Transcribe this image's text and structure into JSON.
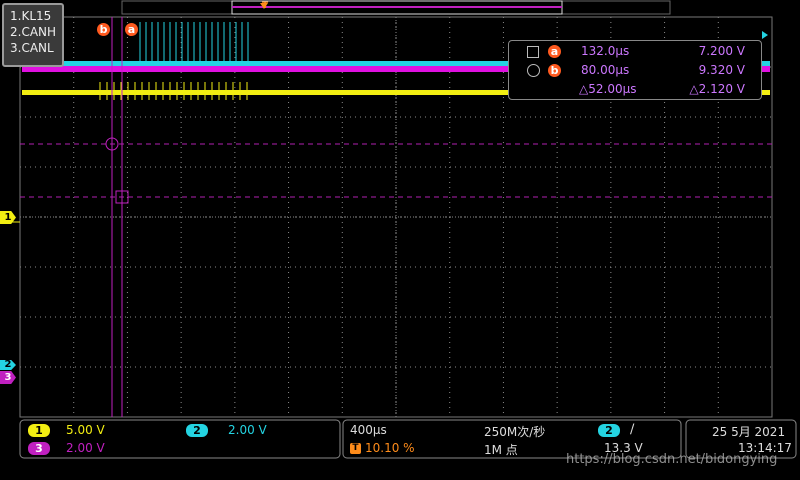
{
  "channel_legend": [
    "1.KL15",
    "2.CANH",
    "3.CANL"
  ],
  "trigger_marker": "T",
  "markers": {
    "b": "b",
    "a": "a"
  },
  "measure": {
    "row_a": {
      "time": "132.0μs",
      "volt": "7.200 V"
    },
    "row_b": {
      "time": "80.00μs",
      "volt": "9.320 V"
    },
    "delta": {
      "time": "△52.00μs",
      "volt": "△2.120 V"
    }
  },
  "channel_tags": {
    "ch1": "1",
    "ch2": "2",
    "ch3": "3"
  },
  "bottom": {
    "ch1": {
      "num": "1",
      "scale": "5.00 V"
    },
    "ch2": {
      "num": "2",
      "scale": "2.00 V"
    },
    "ch3": {
      "num": "3",
      "scale": "2.00 V"
    },
    "timebase": "400μs",
    "trig_pos": "10.10 %",
    "sample_rate": "250M次/秒",
    "mem_depth": "1M 点",
    "trig_src": "2",
    "trig_edge": "∕",
    "trig_level": "13.3 V",
    "date": "25 5月 2021",
    "time": "13:14:17"
  },
  "watermark": "https://blog.csdn.net/bidongying",
  "colors": {
    "ch1": "#f2ee12",
    "ch2": "#24d4e2",
    "ch3": "#c020c0",
    "cursor": "#ff5a1f",
    "grid": "#9a9a9a"
  }
}
